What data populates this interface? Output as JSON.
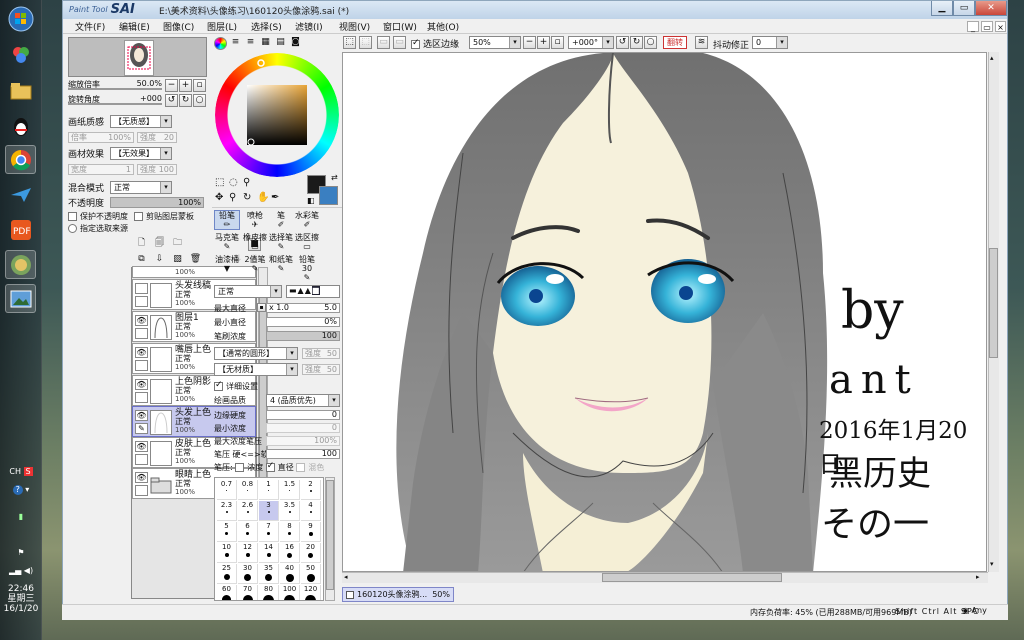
{
  "desktop": {
    "taskbar_icons": [
      "windows-start-icon",
      "app-colorful-icon",
      "folder-icon",
      "qq-penguin-icon",
      "chrome-icon",
      "bird-app-icon",
      "pdf-app-icon",
      "paint-sai-icon",
      "image-viewer-icon"
    ],
    "tray": {
      "lang": "CH",
      "ime": "S",
      "time": "22:46",
      "weekday": "星期三",
      "date": "16/1/20"
    }
  },
  "window": {
    "logo_small": "Paint Tool",
    "logo_big": "SAI",
    "title": "E:\\美术资料\\头像练习\\160120头像涂鸦.sai (*)",
    "menu": [
      "文件(F)",
      "编辑(E)",
      "图像(C)",
      "图层(L)",
      "选择(S)",
      "滤镜(I)",
      "视图(V)",
      "窗口(W)",
      "其他(O)"
    ]
  },
  "navigator": {
    "zoom_label": "缩放倍率",
    "zoom_value": "50.0%",
    "angle_label": "旋转角度",
    "angle_value": "+000"
  },
  "layer_props": {
    "paper_label": "画纸质感",
    "paper_value": "【无质感】",
    "scale_label": "倍率",
    "scale_value": "100%",
    "strength_label": "强度",
    "strength_value": "20",
    "effect_label": "画材效果",
    "effect_value": "【无效果】",
    "width_label": "宽度",
    "width_value": "1",
    "effect_strength_label": "强度",
    "effect_strength_value": "100",
    "blend_label": "混合模式",
    "blend_value": "正常",
    "opacity_label": "不透明度",
    "opacity_value": "100%",
    "protect_label": "保护不透明度",
    "clip_label": "剪贴图层蒙板",
    "select_source_label": "指定选取来源"
  },
  "layers": [
    {
      "name": "",
      "mode": "",
      "opacity": "100%"
    },
    {
      "name": "头发线稿",
      "mode": "正常",
      "opacity": "100%"
    },
    {
      "name": "图层1",
      "mode": "正常",
      "opacity": "100%"
    },
    {
      "name": "嘴唇上色",
      "mode": "正常",
      "opacity": "100%"
    },
    {
      "name": "上色阴影",
      "mode": "正常",
      "opacity": "100%"
    },
    {
      "name": "头发上色",
      "mode": "正常",
      "opacity": "100%"
    },
    {
      "name": "皮肤上色",
      "mode": "正常",
      "opacity": "100%"
    },
    {
      "name": "眼睛上色",
      "mode": "正常",
      "opacity": "100%"
    }
  ],
  "colors": {
    "primary": "#1a1a1a",
    "secondary": "#3a7fc1",
    "selection": "#c7c9ee",
    "accent": "#6f87c7"
  },
  "tools": [
    [
      "铅笔",
      "喷枪",
      "笔",
      "水彩笔"
    ],
    [
      "马克笔",
      "橡皮擦",
      "选择笔",
      "选区擦"
    ],
    [
      "油漆桶",
      "2值笔",
      "和纸笔",
      "铅笔30"
    ]
  ],
  "brush": {
    "mode_value": "正常",
    "max_size_label": "最大直径",
    "max_size_mult": "x 1.0",
    "max_size_value": "5.0",
    "min_size_label": "最小直径",
    "min_size_value": "0%",
    "density_label": "笔刷浓度",
    "density_value": "100",
    "shape_value": "【通常的圆形】",
    "shape_strength": "强度",
    "shape_strength_value": "50",
    "texture_value": "【无材质】",
    "texture_strength": "强度",
    "texture_strength_value": "50",
    "detail_label": "详细设置",
    "quality_label": "绘画品质",
    "quality_value": "4 (品质优先)",
    "edge_label": "边缘硬度",
    "edge_value": "0",
    "min_density_label": "最小浓度",
    "min_density_value": "0",
    "max_pressure_label": "最大浓度笔压",
    "max_pressure_value": "100%",
    "pressure_label": "笔压",
    "pressure_hard": "硬<=>软",
    "pressure_value": "100",
    "pressure_opts_label": "笔压:",
    "pressure_opt1": "浓度",
    "pressure_opt2": "直径",
    "pressure_opt3": "混色",
    "sizes": [
      "0.7",
      "0.8",
      "1",
      "1.5",
      "2",
      "2.3",
      "2.6",
      "3",
      "3.5",
      "4",
      "5",
      "6",
      "7",
      "8",
      "9",
      "10",
      "12",
      "14",
      "16",
      "20",
      "25",
      "30",
      "35",
      "40",
      "50",
      "60",
      "70",
      "80",
      "100",
      "120"
    ]
  },
  "toolbar": {
    "selection_edge": "选区边缘",
    "zoom": "50%",
    "angle": "+000°",
    "flip": "翻转",
    "stabilizer_label": "抖动修正",
    "stabilizer_value": "0"
  },
  "canvas_text": {
    "line1": "by",
    "line2": "ant",
    "line3": "2016年1月20日",
    "line4": "黑历史",
    "line5": "その一"
  },
  "doc_tab": {
    "name": "160120头像涂鸦...",
    "zoom": "50%"
  },
  "status": {
    "memory": "内存负荷率: 45% (已用288MB/可用969MB)",
    "keys": [
      "Shift",
      "Ctrl",
      "Alt",
      "SPC"
    ],
    "any": "Any"
  }
}
